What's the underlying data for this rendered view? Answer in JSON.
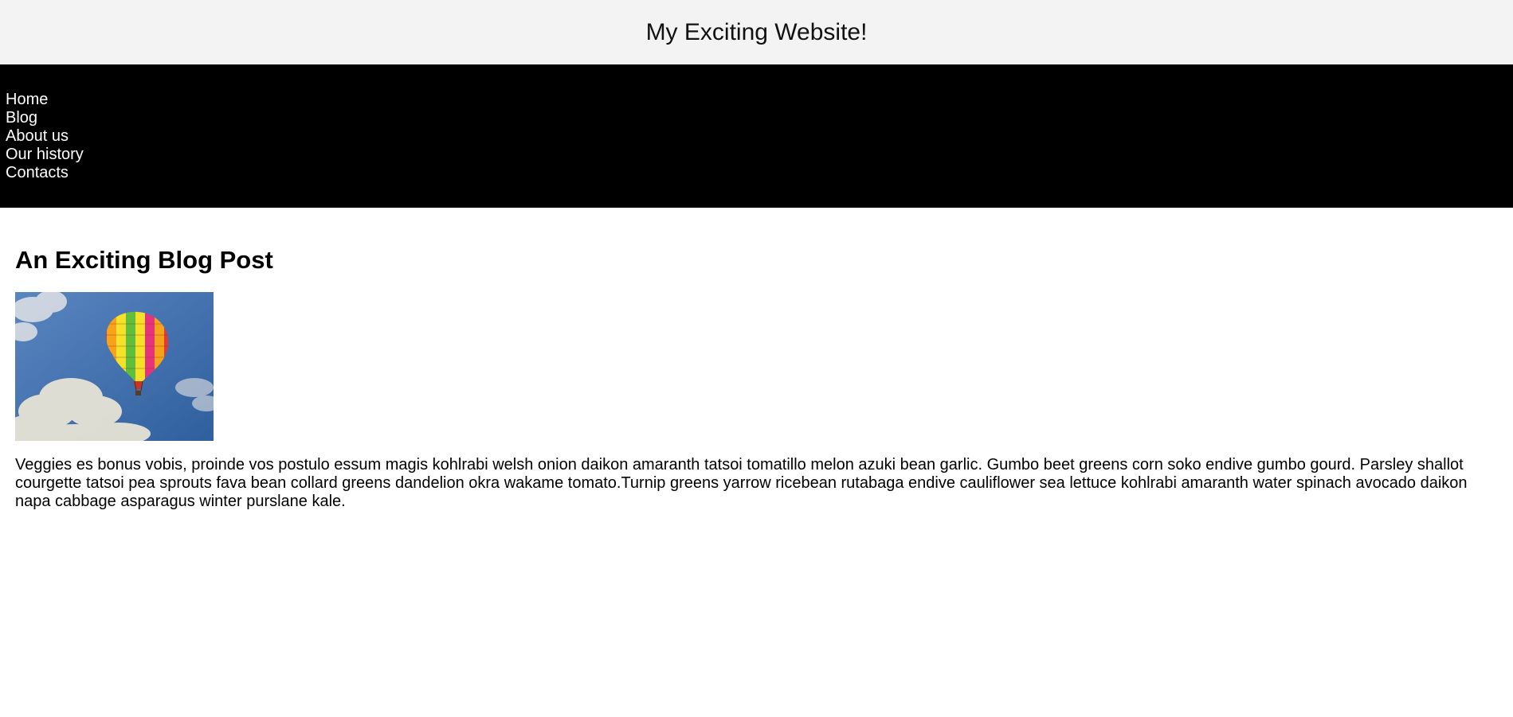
{
  "header": {
    "title": "My Exciting Website!"
  },
  "nav": {
    "items": [
      {
        "label": "Home"
      },
      {
        "label": "Blog"
      },
      {
        "label": "About us"
      },
      {
        "label": "Our history"
      },
      {
        "label": "Contacts"
      }
    ]
  },
  "post": {
    "title": "An Exciting Blog Post",
    "image_icon": "hot-air-balloon-image",
    "body": "Veggies es bonus vobis, proinde vos postulo essum magis kohlrabi welsh onion daikon amaranth tatsoi tomatillo melon azuki bean garlic. Gumbo beet greens corn soko endive gumbo gourd. Parsley shallot courgette tatsoi pea sprouts fava bean collard greens dandelion okra wakame tomato.Turnip greens yarrow ricebean rutabaga endive cauliflower sea lettuce kohlrabi amaranth water spinach avocado daikon napa cabbage asparagus winter purslane kale."
  },
  "colors": {
    "header_bg": "#f3f3f3",
    "nav_bg": "#000000",
    "nav_text": "#ffffff",
    "sky": "#3f6fb0"
  }
}
